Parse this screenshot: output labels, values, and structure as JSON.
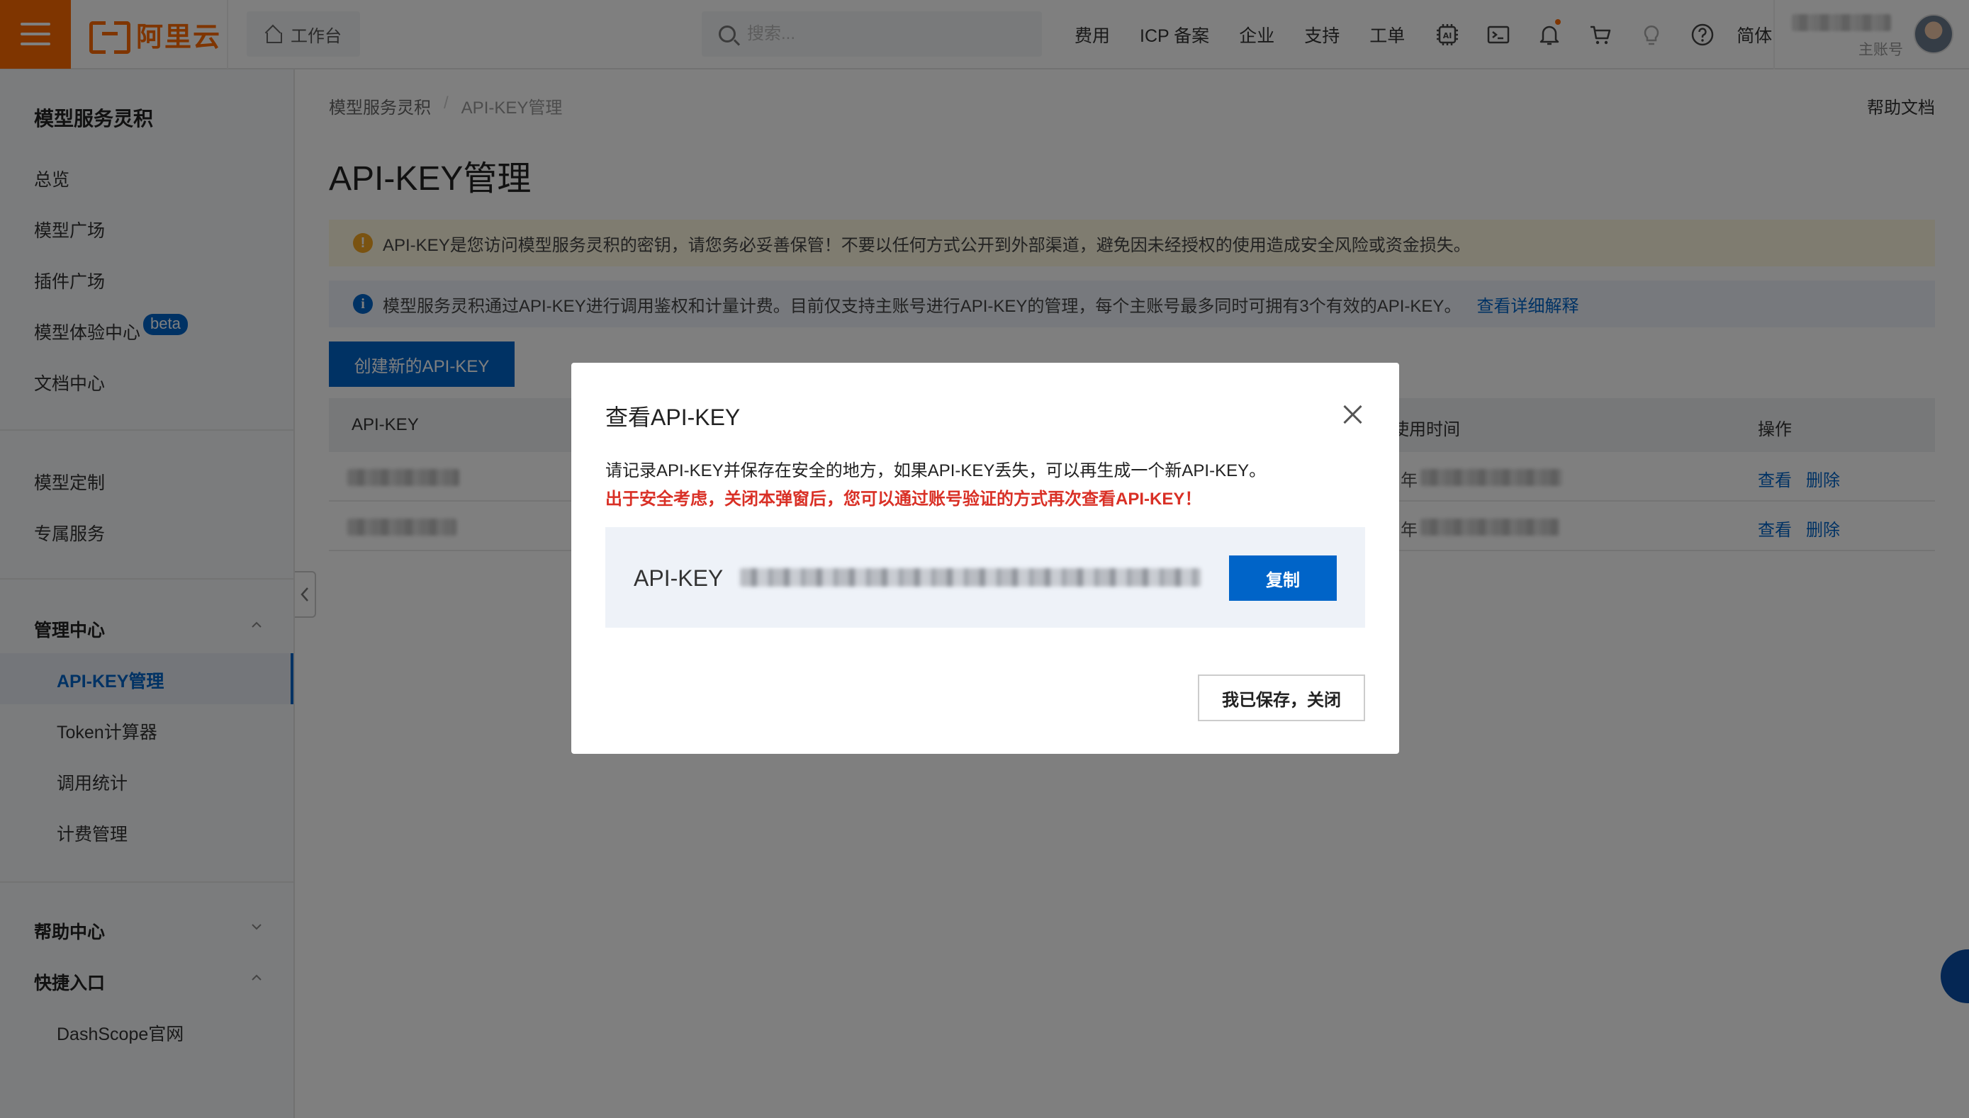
{
  "header": {
    "brand": "阿里云",
    "workbench": "工作台",
    "search_placeholder": "搜索...",
    "nav": [
      "费用",
      "ICP 备案",
      "企业",
      "支持",
      "工单"
    ],
    "language": "简体",
    "account_role": "主账号",
    "accent_color": "#ff6a00"
  },
  "sidebar": {
    "title": "模型服务灵积",
    "items": [
      "总览",
      "模型广场",
      "插件广场",
      "模型体验中心",
      "文档中心"
    ],
    "beta_badge": "beta",
    "items2": [
      "模型定制",
      "专属服务"
    ],
    "management": {
      "label": "管理中心",
      "children": [
        "API-KEY管理",
        "Token计算器",
        "调用统计",
        "计费管理"
      ],
      "active": "API-KEY管理"
    },
    "help_center": "帮助中心",
    "quick_entry": {
      "label": "快捷入口",
      "children": [
        "DashScope官网"
      ]
    }
  },
  "main": {
    "breadcrumb": [
      "模型服务灵积",
      "/",
      "API-KEY管理"
    ],
    "help_doc": "帮助文档",
    "title": "API-KEY管理",
    "warning": "API-KEY是您访问模型服务灵积的密钥，请您务必妥善保管！不要以任何方式公开到外部渠道，避免因未经授权的使用造成安全风险或资金损失。",
    "info": "模型服务灵积通过API-KEY进行调用鉴权和计量计费。目前仅支持主账号进行API-KEY的管理，每个主账号最多同时可拥有3个有效的API-KEY。",
    "info_link": "查看详细解释",
    "create_button": "创建新的API-KEY",
    "table": {
      "col_key": "API-KEY",
      "col_time": "使用时间",
      "col_action": "操作",
      "rows": [
        {
          "year_fragment": "年",
          "view": "查看",
          "delete": "删除"
        },
        {
          "year_fragment": "年",
          "view": "查看",
          "delete": "删除"
        }
      ]
    }
  },
  "modal": {
    "title": "查看API-KEY",
    "description": "请记录API-KEY并保存在安全的地方，如果API-KEY丢失，可以再生成一个新API-KEY。",
    "warning": "出于安全考虑，关闭本弹窗后，您可以通过账号验证的方式再次查看API-KEY！",
    "key_label": "API-KEY",
    "copy_button": "复制",
    "close_button": "我已保存，关闭",
    "warning_color": "#d93026"
  },
  "colors": {
    "primary": "#0064c8"
  },
  "icons": [
    "menu-icon",
    "home-icon",
    "search-icon",
    "ai-chip-icon",
    "terminal-icon",
    "bell-icon",
    "cart-icon",
    "lightbulb-icon",
    "help-icon",
    "chevron-up-icon",
    "chevron-down-icon",
    "chevron-left-icon",
    "close-icon"
  ]
}
